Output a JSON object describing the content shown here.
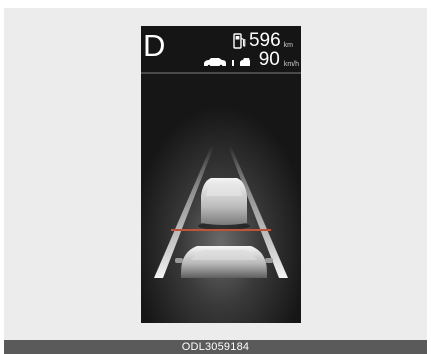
{
  "cluster": {
    "gear": "D",
    "range_value": "596",
    "range_unit": "km",
    "set_speed_value": "90",
    "set_speed_unit": "km/h"
  },
  "icons": {
    "fuel": "fuel-pump-icon",
    "lead_vehicle": "lead-vehicle-icon",
    "own_vehicle": "own-vehicle-icon",
    "distance": "following-distance-icon"
  },
  "colors": {
    "panel_background": "#151515",
    "distance_line": "#c0533a",
    "text": "#ffffff",
    "caption_bar": "#5a5a5a"
  },
  "caption": "ODL3059184"
}
